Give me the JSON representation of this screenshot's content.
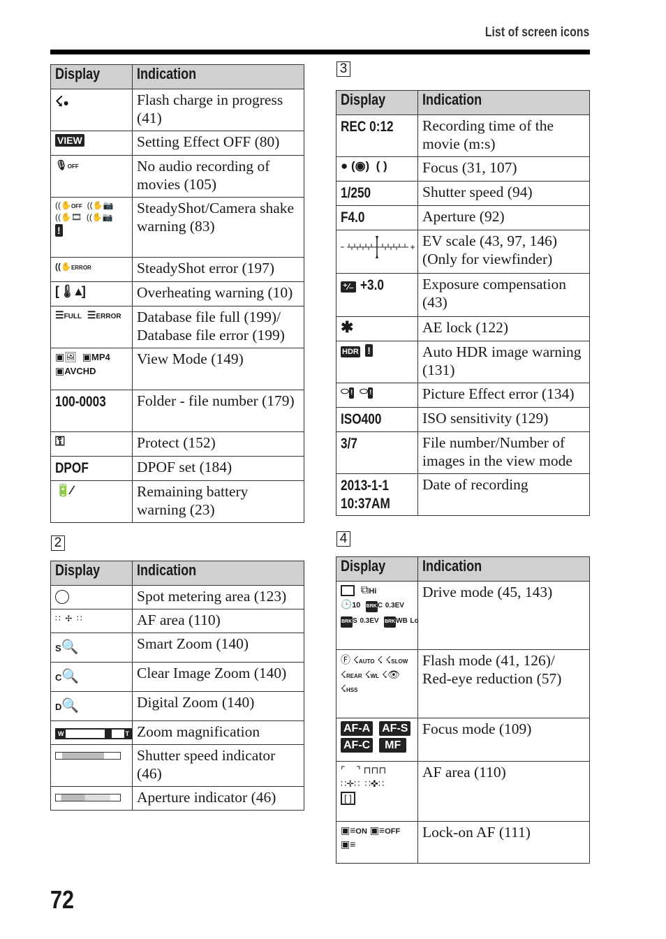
{
  "header": {
    "title": "List of screen icons"
  },
  "page_number": "72",
  "table_headers": {
    "display": "Display",
    "indication": "Indication"
  },
  "section1": {
    "rows": [
      {
        "icon": "flash-charge-icon",
        "indication": "Flash charge in progress (41)"
      },
      {
        "icon": "view-badge-icon",
        "display_text": "VIEW",
        "indication": "Setting Effect OFF (80)"
      },
      {
        "icon": "mic-off-icon",
        "display_text": "OFF",
        "indication": "No audio recording of movies (105)"
      },
      {
        "icon": "steadyshot-warning-icons",
        "display_text": [
          "OFF"
        ],
        "indication": "SteadyShot/Camera shake warning (83)"
      },
      {
        "icon": "steadyshot-error-icon",
        "display_text": "ERROR",
        "indication": "SteadyShot error (197)"
      },
      {
        "icon": "overheating-icon",
        "indication": "Overheating warning (10)"
      },
      {
        "icon": "database-icons",
        "display_text": [
          "FULL",
          "ERROR"
        ],
        "indication": "Database file full (199)/ Database file error (199)"
      },
      {
        "icon": "view-mode-icons",
        "display_text": [
          "MP4",
          "AVCHD"
        ],
        "indication": "View Mode (149)"
      },
      {
        "display_text": "100-0003",
        "indication": "Folder - file number (179)"
      },
      {
        "icon": "protect-key-icon",
        "indication": "Protect (152)"
      },
      {
        "display_text": "DPOF",
        "indication": "DPOF set (184)"
      },
      {
        "icon": "battery-warning-icon",
        "indication": "Remaining battery warning (23)"
      }
    ]
  },
  "section2": {
    "label": "2",
    "rows": [
      {
        "icon": "spot-metering-circle-icon",
        "indication": "Spot metering area (123)"
      },
      {
        "icon": "af-area-points-icon",
        "indication": "AF area (110)"
      },
      {
        "icon": "smart-zoom-icon",
        "display_text": "S",
        "indication": "Smart Zoom (140)"
      },
      {
        "icon": "clear-image-zoom-icon",
        "display_text": "C",
        "indication": "Clear Image Zoom (140)"
      },
      {
        "icon": "digital-zoom-icon",
        "display_text": "D",
        "indication": "Digital Zoom (140)"
      },
      {
        "icon": "zoom-bar-icon",
        "display_text": [
          "W",
          "T"
        ],
        "indication": "Zoom magnification"
      },
      {
        "icon": "shutter-speed-indicator-icon",
        "indication": "Shutter speed indicator (46)"
      },
      {
        "icon": "aperture-indicator-icon",
        "indication": "Aperture indicator (46)"
      }
    ]
  },
  "section3": {
    "label": "3",
    "rows": [
      {
        "display_text": "REC 0:12",
        "indication": "Recording time of the movie (m:s)"
      },
      {
        "icon": "focus-indicator-icons",
        "indication": "Focus (31, 107)"
      },
      {
        "display_text": "1/250",
        "indication": "Shutter speed (94)"
      },
      {
        "display_text": "F4.0",
        "indication": "Aperture (92)"
      },
      {
        "icon": "ev-scale-icon",
        "indication": "EV scale (43, 97, 146) (Only for viewfinder)"
      },
      {
        "icon": "exposure-comp-icon",
        "display_text": "+3.0",
        "indication": "Exposure compensation (43)"
      },
      {
        "icon": "ae-lock-asterisk-icon",
        "indication": "AE lock (122)"
      },
      {
        "icon": "hdr-warning-icons",
        "display_text": "HDR",
        "indication": "Auto HDR image warning (131)"
      },
      {
        "icon": "picture-effect-error-icons",
        "indication": "Picture Effect error (134)"
      },
      {
        "display_text": "ISO400",
        "indication": "ISO sensitivity (129)"
      },
      {
        "display_text": "3/7",
        "indication": "File number/Number of images in the view mode"
      },
      {
        "display_text": [
          "2013-1-1",
          "10:37AM"
        ],
        "indication": "Date of recording"
      }
    ]
  },
  "section4": {
    "label": "4",
    "rows": [
      {
        "icon": "drive-mode-icons",
        "display_text": [
          "Hi",
          "10",
          "C",
          "0.3EV",
          "S",
          "0.3EV",
          "WB",
          "Lo"
        ],
        "indication": "Drive mode (45, 143)"
      },
      {
        "icon": "flash-mode-icons",
        "display_text": [
          "AUTO",
          "SLOW",
          "REAR",
          "WL",
          "HSS"
        ],
        "indication": "Flash mode (41, 126)/ Red-eye reduction (57)"
      },
      {
        "icon": "focus-mode-badges",
        "display_text": [
          "AF-A",
          "AF-S",
          "AF-C",
          "MF"
        ],
        "indication": "Focus mode (109)"
      },
      {
        "icon": "af-area-icons",
        "indication": "AF area (110)"
      },
      {
        "icon": "lock-on-af-icons",
        "display_text": [
          "ON",
          "OFF"
        ],
        "indication": "Lock-on AF (111)"
      }
    ]
  }
}
